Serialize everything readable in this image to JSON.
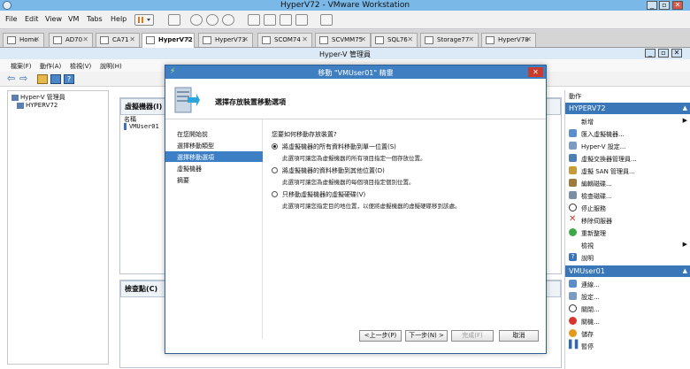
{
  "vmware": {
    "title": "HyperV72 - VMware Workstation",
    "menu": [
      "File",
      "Edit",
      "View",
      "VM",
      "Tabs",
      "Help"
    ],
    "tabs": [
      "Home",
      "AD70",
      "CA71",
      "HyperV72",
      "HyperV73",
      "SCOM74",
      "SCVMM75",
      "SQL76",
      "Storage77",
      "HyperV78"
    ],
    "active_tab": "HyperV72",
    "win_controls": [
      "_",
      "▫",
      "✕"
    ]
  },
  "hyperv": {
    "title": "Hyper-V 管理員",
    "menu": [
      "檔案(F)",
      "動作(A)",
      "檢視(V)",
      "說明(H)"
    ],
    "tree_root": "Hyper-V 管理員",
    "tree_server": "HYPERV72",
    "vm_panel_title": "虛擬機器(I)",
    "vm_col_name": "名稱",
    "vm_name": "VMUser01",
    "checkpoint_panel_title": "檢查點(C)",
    "actions_title": "動作",
    "actions_server_header": "HYPERV72",
    "server_actions": [
      "新增",
      "匯入虛擬機器...",
      "Hyper-V 設定...",
      "虛擬交換器管理員...",
      "虛擬 SAN 管理員...",
      "編輯磁碟...",
      "檢查磁碟...",
      "停止服務",
      "移除伺服器",
      "重新整理",
      "檢視",
      "說明"
    ],
    "actions_vm_header": "VMUser01",
    "vm_actions": [
      "連線...",
      "設定...",
      "關閉...",
      "關機...",
      "儲存",
      "暫停"
    ],
    "colors": {
      "action_header": "#3a77b8",
      "selection": "#3c7fc4"
    }
  },
  "wizard": {
    "title": "移動 \"VMUser01\" 精靈",
    "heading": "選擇存放裝置移動選項",
    "nav": [
      "在您開始前",
      "選擇移動類型",
      "選擇移動選項",
      "虛擬機器",
      "摘要"
    ],
    "selected_nav": "選擇移動選項",
    "question": "您要如何移動存放裝置?",
    "options": [
      {
        "label": "將虛擬機器的所有資料移動到單一位置(S)",
        "desc": "此選項可讓您為虛擬機器的所有項目指定一個存放位置。",
        "checked": true
      },
      {
        "label": "將虛擬機器的資料移動到其他位置(D)",
        "desc": "此選項可讓您為虛擬機器的每個項目指定個別位置。",
        "checked": false
      },
      {
        "label": "只移動虛擬機器的虛擬硬碟(V)",
        "desc": "此選項可讓您指定目的地位置，以便將虛擬機器的虛擬硬碟移到該處。",
        "checked": false
      }
    ],
    "buttons": {
      "prev": "<上一步(P)",
      "next": "下一步(N) >",
      "finish": "完成(F)",
      "cancel": "取消"
    }
  }
}
